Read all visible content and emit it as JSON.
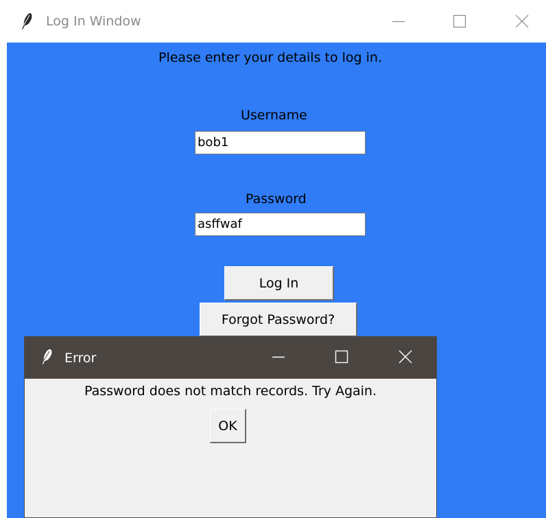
{
  "main_window": {
    "title": "Log In Window",
    "instructions": "Please enter your details to log in.",
    "username": {
      "label": "Username",
      "value": "bob1"
    },
    "password": {
      "label": "Password",
      "value": "asffwaf"
    },
    "login_button": "Log In",
    "forgot_button": "Forgot Password?",
    "background_color": "#2f7cf6"
  },
  "dialog": {
    "title": "Error",
    "message": "Password does not match records. Try Again.",
    "ok_button": "OK",
    "titlebar_color": "#4a4541"
  },
  "icons": {
    "app_icon": "feather-icon",
    "minimize": "minimize-icon",
    "maximize": "maximize-icon",
    "close": "close-icon"
  }
}
